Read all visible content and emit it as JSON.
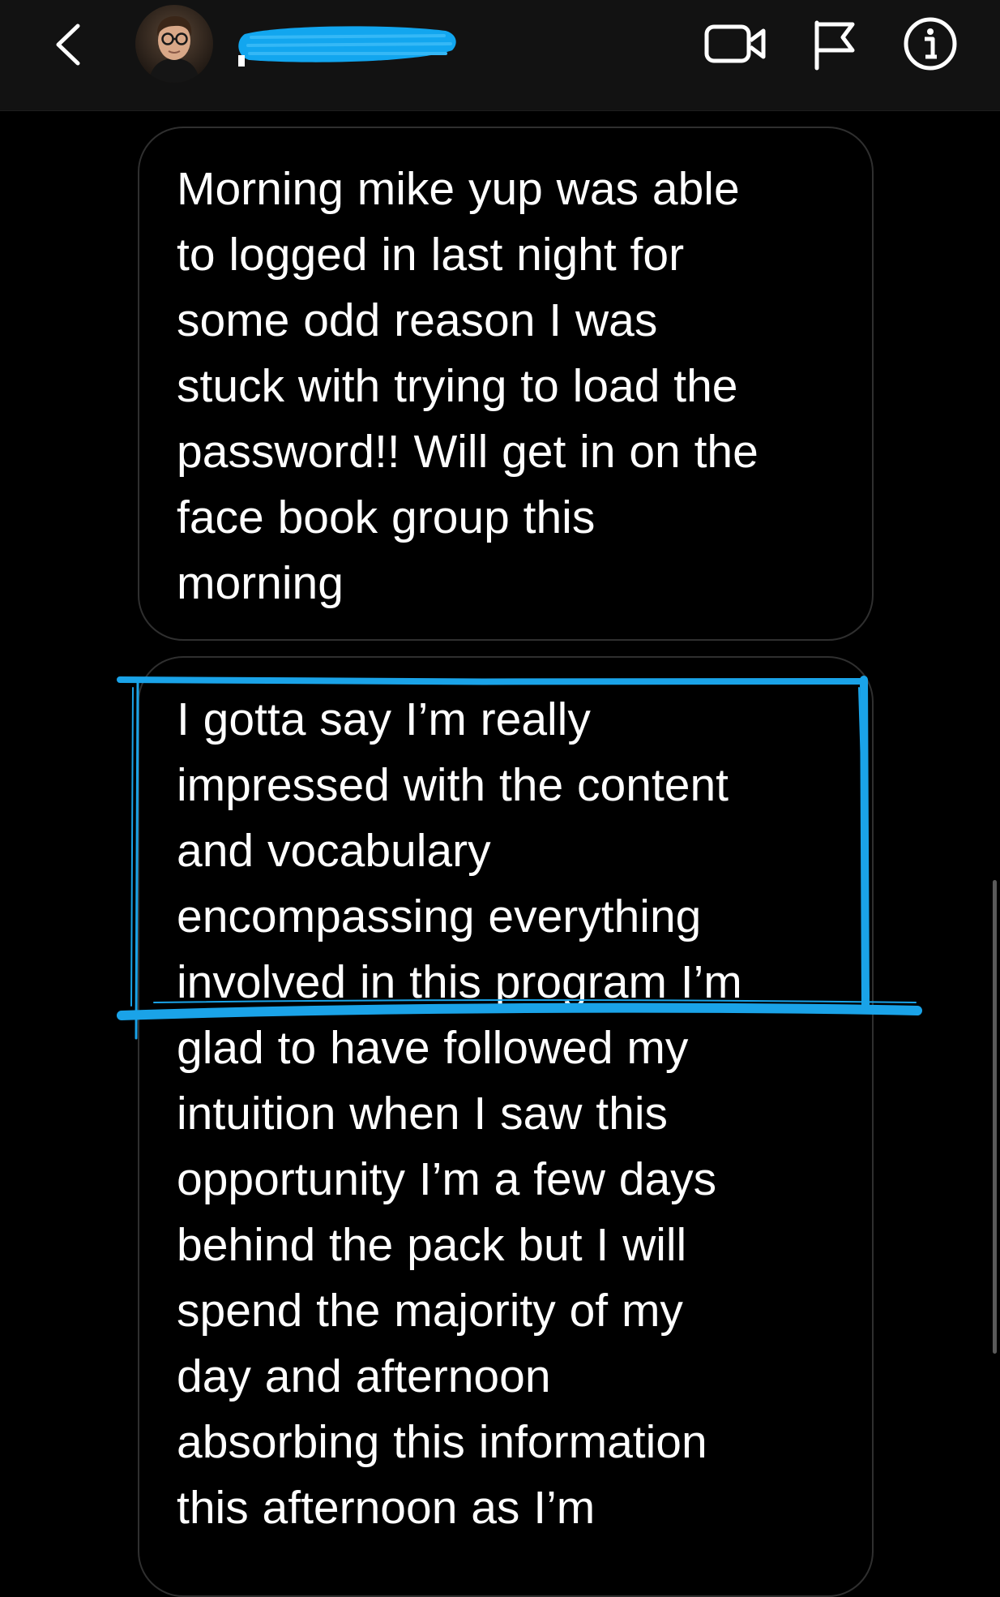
{
  "header": {
    "back_icon": "chevron-left-icon",
    "username": "",
    "video_icon": "video-camera-icon",
    "flag_icon": "flag-icon",
    "info_icon": "info-icon"
  },
  "messages": [
    {
      "text": "Morning mike yup was able\nto logged in last night for\nsome odd reason I was\nstuck with trying to load the\npassword!! Will get in on the\nface book group this\nmorning"
    },
    {
      "text": "I gotta say I’m really\nimpressed with the content\nand vocabulary\nencompassing everything\ninvolved in this program I’m\nglad to have followed my\nintuition when I saw this\nopportunity I’m a few days\nbehind the pack but I will\nspend the majority of my\nday and afternoon\nabsorbing this information\nthis afternoon as I’m"
    }
  ],
  "colors": {
    "background": "#000000",
    "header_background": "#121212",
    "bubble_border": "#2f2f2f",
    "text": "#ffffff",
    "annotation": "#1aa3e8"
  }
}
